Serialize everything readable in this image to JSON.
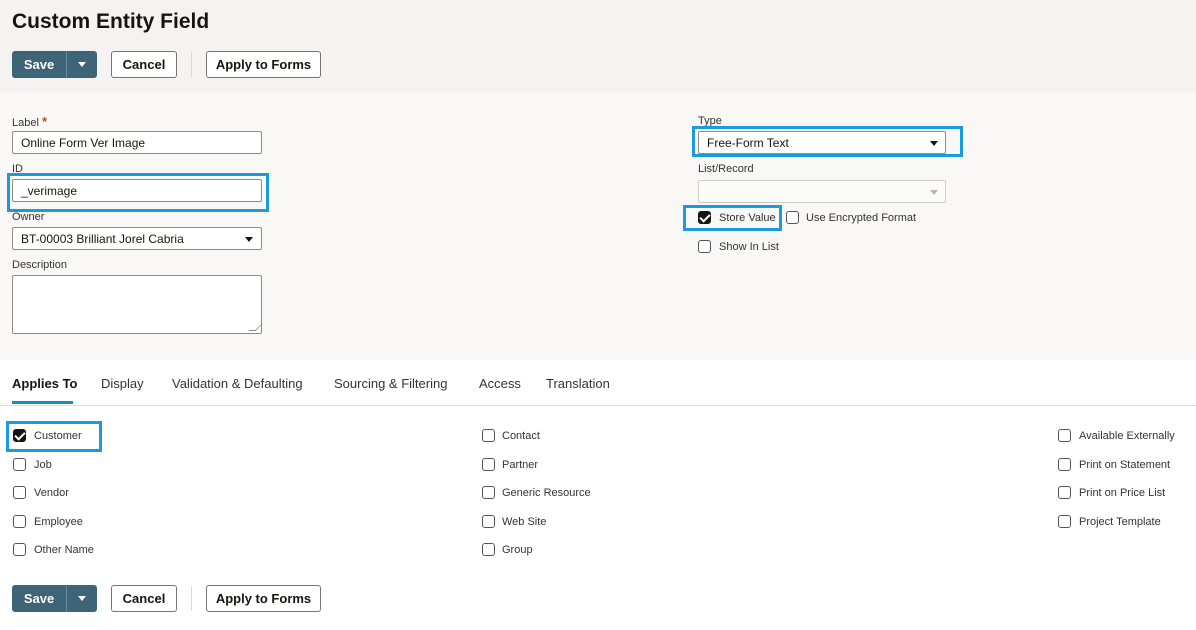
{
  "page": {
    "title": "Custom Entity Field"
  },
  "actions": {
    "save": "Save",
    "cancel": "Cancel",
    "apply": "Apply to Forms"
  },
  "form": {
    "label": {
      "caption": "Label",
      "required_mark": "*",
      "value": "Online Form Ver Image"
    },
    "id": {
      "caption": "ID",
      "value": "_verimage"
    },
    "owner": {
      "caption": "Owner",
      "value": "BT-00003 Brilliant Jorel Cabria"
    },
    "description": {
      "caption": "Description",
      "value": ""
    },
    "type": {
      "caption": "Type",
      "value": "Free-Form Text"
    },
    "list_record": {
      "caption": "List/Record",
      "value": ""
    },
    "store_value": {
      "label": "Store Value",
      "checked": true
    },
    "use_encrypted": {
      "label": "Use Encrypted Format",
      "checked": false
    },
    "show_in_list": {
      "label": "Show In List",
      "checked": false
    }
  },
  "tabs": [
    {
      "label": "Applies To",
      "active": true
    },
    {
      "label": "Display"
    },
    {
      "label": "Validation & Defaulting"
    },
    {
      "label": "Sourcing & Filtering"
    },
    {
      "label": "Access"
    },
    {
      "label": "Translation"
    }
  ],
  "applies_to": {
    "col1": [
      {
        "label": "Customer",
        "checked": true
      },
      {
        "label": "Job",
        "checked": false
      },
      {
        "label": "Vendor",
        "checked": false
      },
      {
        "label": "Employee",
        "checked": false
      },
      {
        "label": "Other Name",
        "checked": false
      }
    ],
    "col2": [
      {
        "label": "Contact",
        "checked": false
      },
      {
        "label": "Partner",
        "checked": false
      },
      {
        "label": "Generic Resource",
        "checked": false
      },
      {
        "label": "Web Site",
        "checked": false
      },
      {
        "label": "Group",
        "checked": false
      }
    ],
    "col3": [
      {
        "label": "Available Externally",
        "checked": false
      },
      {
        "label": "Print on Statement",
        "checked": false
      },
      {
        "label": "Print on Price List",
        "checked": false
      },
      {
        "label": "Project Template",
        "checked": false
      }
    ]
  },
  "colors": {
    "primary_button": "#3e6478",
    "highlight": "#1a9be0",
    "tab_accent": "#1a8fb5"
  }
}
